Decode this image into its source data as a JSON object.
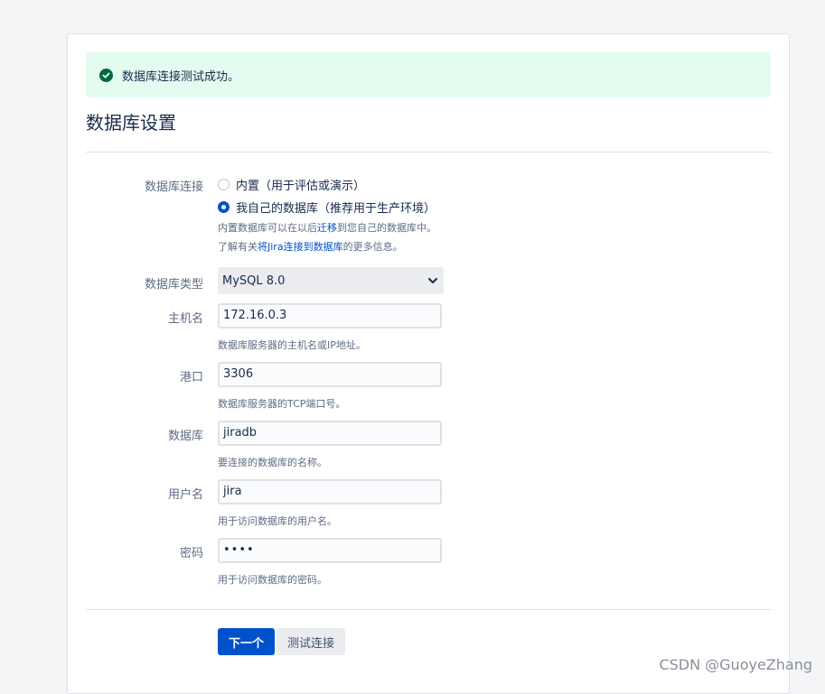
{
  "alert": {
    "message": "数据库连接测试成功。",
    "icon": "check-circle-icon"
  },
  "page_title": "数据库设置",
  "connection": {
    "label": "数据库连接",
    "options": [
      {
        "label": "内置（用于评估或演示）",
        "checked": false
      },
      {
        "label": "我自己的数据库（推荐用于生产环境）",
        "checked": true
      }
    ],
    "hint1_a": "内置数据库可以在以后",
    "hint1_link": "迁移",
    "hint1_b": "到您自己的数据库中。",
    "hint2_a": "了解有关",
    "hint2_link": "将Jira连接到数据库",
    "hint2_b": "的更多信息。"
  },
  "db_type": {
    "label": "数据库类型",
    "value": "MySQL 8.0"
  },
  "hostname": {
    "label": "主机名",
    "value": "172.16.0.3",
    "hint": "数据库服务器的主机名或IP地址。"
  },
  "port": {
    "label": "港口",
    "value": "3306",
    "hint": "数据库服务器的TCP端口号。"
  },
  "database": {
    "label": "数据库",
    "value": "jiradb",
    "hint": "要连接的数据库的名称。"
  },
  "username": {
    "label": "用户名",
    "value": "jira",
    "hint": "用于访问数据库的用户名。"
  },
  "password": {
    "label": "密码",
    "value": "••••",
    "hint": "用于访问数据库的密码。"
  },
  "buttons": {
    "next": "下一个",
    "test": "测试连接"
  },
  "watermark": "CSDN @GuoyeZhang",
  "colors": {
    "primary": "#0052cc",
    "success_bg": "#e3fcef",
    "success_icon": "#006644"
  }
}
